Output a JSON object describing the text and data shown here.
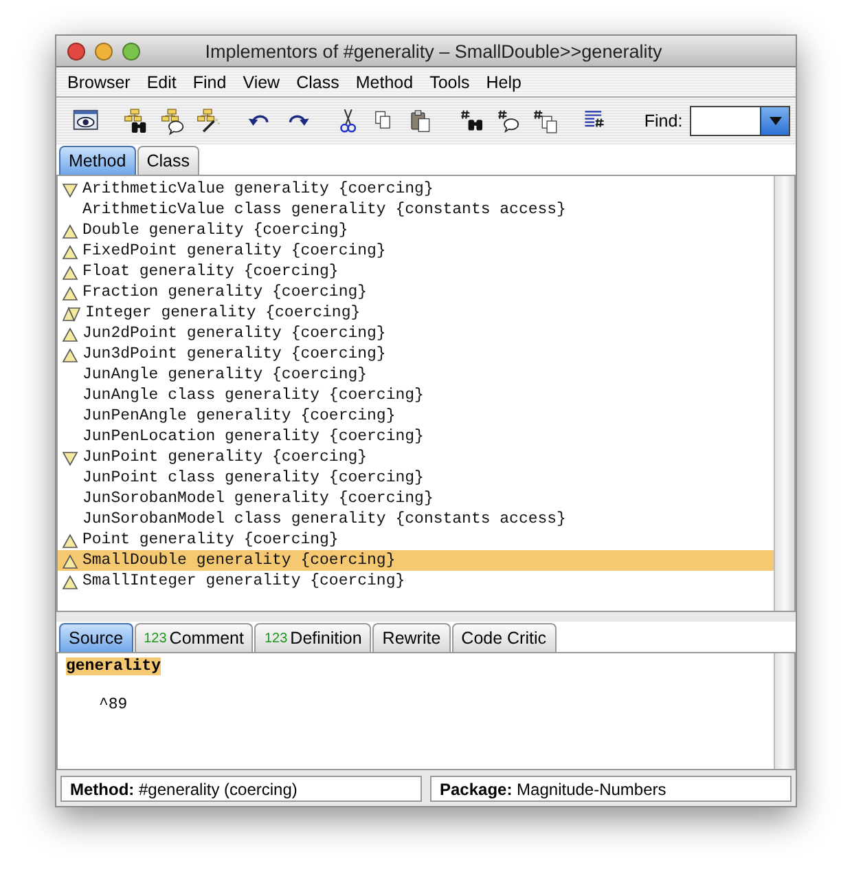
{
  "window": {
    "title": "Implementors of #generality – SmallDouble>>generality"
  },
  "menu": [
    "Browser",
    "Edit",
    "Find",
    "View",
    "Class",
    "Method",
    "Tools",
    "Help"
  ],
  "find": {
    "label": "Find:"
  },
  "list_tabs": [
    {
      "label": "Method",
      "selected": true
    },
    {
      "label": "Class",
      "selected": false
    }
  ],
  "methods": [
    {
      "text": "ArithmeticValue generality {coercing}",
      "kind": "down",
      "selected": false
    },
    {
      "text": "ArithmeticValue class generality {constants access}",
      "kind": "none",
      "selected": false
    },
    {
      "text": "Double generality {coercing}",
      "kind": "up",
      "selected": false
    },
    {
      "text": "FixedPoint generality {coercing}",
      "kind": "up",
      "selected": false
    },
    {
      "text": "Float generality {coercing}",
      "kind": "up",
      "selected": false
    },
    {
      "text": "Fraction generality {coercing}",
      "kind": "up",
      "selected": false
    },
    {
      "text": "Integer generality {coercing}",
      "kind": "both",
      "selected": false
    },
    {
      "text": "Jun2dPoint generality {coercing}",
      "kind": "up",
      "selected": false
    },
    {
      "text": "Jun3dPoint generality {coercing}",
      "kind": "up",
      "selected": false
    },
    {
      "text": "JunAngle generality {coercing}",
      "kind": "none",
      "selected": false
    },
    {
      "text": "JunAngle class generality {coercing}",
      "kind": "none",
      "selected": false
    },
    {
      "text": "JunPenAngle generality {coercing}",
      "kind": "none",
      "selected": false
    },
    {
      "text": "JunPenLocation generality {coercing}",
      "kind": "none",
      "selected": false
    },
    {
      "text": "JunPoint generality {coercing}",
      "kind": "down",
      "selected": false
    },
    {
      "text": "JunPoint class generality {coercing}",
      "kind": "none",
      "selected": false
    },
    {
      "text": "JunSorobanModel generality {coercing}",
      "kind": "none",
      "selected": false
    },
    {
      "text": "JunSorobanModel class generality {constants access}",
      "kind": "none",
      "selected": false
    },
    {
      "text": "Point generality {coercing}",
      "kind": "up",
      "selected": false
    },
    {
      "text": "SmallDouble generality {coercing}",
      "kind": "up",
      "selected": true
    },
    {
      "text": "SmallInteger generality {coercing}",
      "kind": "up",
      "selected": false
    }
  ],
  "source_tabs": [
    {
      "label": "Source",
      "selected": true
    },
    {
      "label": "Comment",
      "badge": "123",
      "selected": false
    },
    {
      "label": "Definition",
      "badge": "123",
      "selected": false
    },
    {
      "label": "Rewrite",
      "selected": false
    },
    {
      "label": "Code Critic",
      "selected": false
    }
  ],
  "source": {
    "selector": "generality",
    "body": "^89"
  },
  "status_bar": [
    {
      "label": "Method:",
      "value": "#generality (coercing)"
    },
    {
      "label": "Package:",
      "value": "Magnitude-Numbers"
    }
  ]
}
